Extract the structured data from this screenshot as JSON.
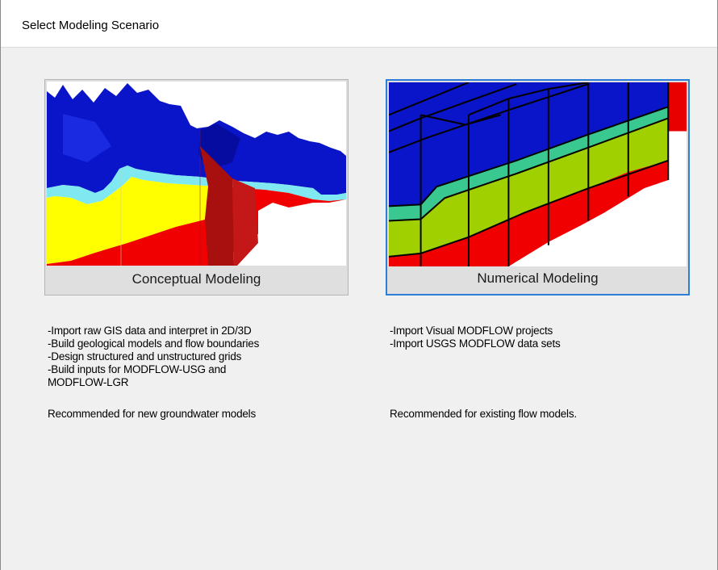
{
  "dialog": {
    "title": "Select Modeling Scenario"
  },
  "options": [
    {
      "label": "Conceptual Modeling",
      "selected": false,
      "bullets": [
        "-Import raw GIS data and interpret in 2D/3D",
        "-Build geological models and flow boundaries",
        "-Design structured and unstructured grids",
        "-Build inputs for MODFLOW-USG and",
        "MODFLOW-LGR"
      ],
      "recommendation": "Recommended for new groundwater models"
    },
    {
      "label": "Numerical Modeling",
      "selected": true,
      "bullets": [
        "-Import Visual MODFLOW projects",
        "-Import USGS MODFLOW data sets"
      ],
      "recommendation": "Recommended for existing flow models."
    }
  ],
  "colors": {
    "selection_border": "#2d7ed6",
    "layer_blue": "#0a14c8",
    "layer_cyan": "#7fe8f0",
    "layer_yellow": "#ffff00",
    "layer_red": "#f00000",
    "layer_green": "#a0d000",
    "layer_teal": "#38c890"
  }
}
